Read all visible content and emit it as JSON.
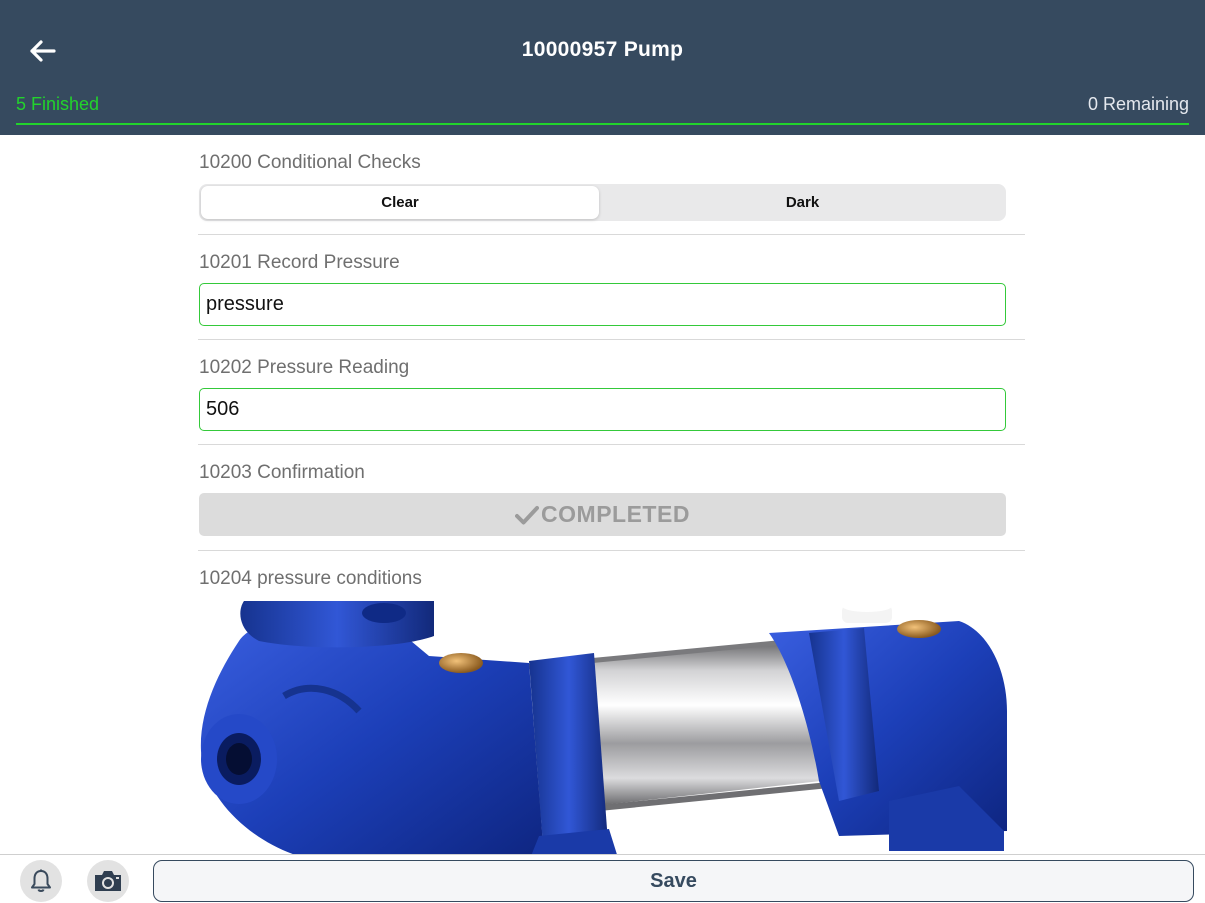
{
  "header": {
    "title": "10000957 Pump",
    "finished": "5 Finished",
    "remaining": "0 Remaining",
    "background_color": "#364a5f",
    "accent_color": "#22d32c",
    "back_icon": "arrow-left-icon"
  },
  "fields": [
    {
      "label": "10200 Conditional Checks",
      "type": "segmented",
      "options": [
        "Clear",
        "Dark"
      ],
      "selected": "Clear"
    },
    {
      "label": "10201 Record Pressure",
      "type": "text",
      "value": "pressure"
    },
    {
      "label": "10202 Pressure Reading",
      "type": "text",
      "value": "506"
    },
    {
      "label": "10203 Confirmation",
      "type": "button",
      "button_label": "COMPLETED",
      "icon": "checkmark-icon"
    },
    {
      "label": "10204 pressure conditions",
      "type": "image",
      "image_subject": "blue-water-pump"
    }
  ],
  "footer": {
    "bell_icon": "bell-icon",
    "camera_icon": "camera-icon",
    "save_label": "Save"
  }
}
